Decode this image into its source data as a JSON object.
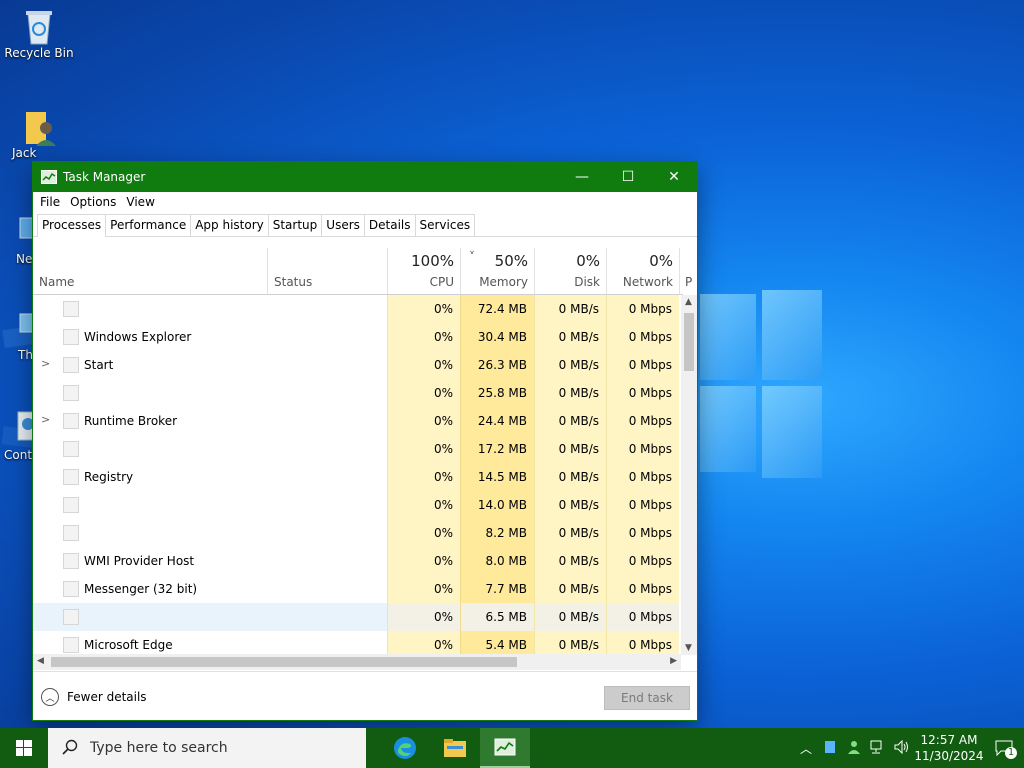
{
  "desktop": {
    "icons": [
      {
        "label": "Recycle Bin"
      },
      {
        "label": "Jack"
      },
      {
        "label": "Ne"
      },
      {
        "label": "Th"
      },
      {
        "label": "Contr"
      }
    ]
  },
  "window": {
    "title": "Task Manager",
    "controls": {
      "minimize": "—",
      "maximize": "☐",
      "close": "✕"
    },
    "menu": [
      "File",
      "Options",
      "View"
    ],
    "tabs": [
      "Processes",
      "Performance",
      "App history",
      "Startup",
      "Users",
      "Details",
      "Services"
    ],
    "active_tab": "Processes",
    "columns": {
      "name": "Name",
      "status": "Status",
      "cpu": {
        "pct": "100%",
        "label": "CPU"
      },
      "memory": {
        "pct": "50%",
        "label": "Memory",
        "sort_icon": "˅"
      },
      "disk": {
        "pct": "0%",
        "label": "Disk"
      },
      "network": {
        "pct": "0%",
        "label": "Network"
      },
      "power_partial": "P"
    },
    "rows": [
      {
        "name": "",
        "expand": "",
        "cpu": "0%",
        "memory": "72.4 MB",
        "disk": "0 MB/s",
        "network": "0 Mbps"
      },
      {
        "name": "Windows Explorer",
        "expand": "",
        "cpu": "0%",
        "memory": "30.4 MB",
        "disk": "0 MB/s",
        "network": "0 Mbps"
      },
      {
        "name": "Start",
        "expand": ">",
        "cpu": "0%",
        "memory": "26.3 MB",
        "disk": "0 MB/s",
        "network": "0 Mbps"
      },
      {
        "name": "",
        "expand": "",
        "cpu": "0%",
        "memory": "25.8 MB",
        "disk": "0 MB/s",
        "network": "0 Mbps"
      },
      {
        "name": "Runtime Broker",
        "expand": ">",
        "cpu": "0%",
        "memory": "24.4 MB",
        "disk": "0 MB/s",
        "network": "0 Mbps"
      },
      {
        "name": "",
        "expand": "",
        "cpu": "0%",
        "memory": "17.2 MB",
        "disk": "0 MB/s",
        "network": "0 Mbps"
      },
      {
        "name": "Registry",
        "expand": "",
        "cpu": "0%",
        "memory": "14.5 MB",
        "disk": "0 MB/s",
        "network": "0 Mbps"
      },
      {
        "name": "",
        "expand": "",
        "cpu": "0%",
        "memory": "14.0 MB",
        "disk": "0 MB/s",
        "network": "0 Mbps"
      },
      {
        "name": "",
        "expand": "",
        "cpu": "0%",
        "memory": "8.2 MB",
        "disk": "0 MB/s",
        "network": "0 Mbps"
      },
      {
        "name": "WMI Provider Host",
        "expand": "",
        "cpu": "0%",
        "memory": "8.0 MB",
        "disk": "0 MB/s",
        "network": "0 Mbps"
      },
      {
        "name": "Messenger (32 bit)",
        "expand": "",
        "cpu": "0%",
        "memory": "7.7 MB",
        "disk": "0 MB/s",
        "network": "0 Mbps"
      },
      {
        "name": "",
        "expand": "",
        "cpu": "0%",
        "memory": "6.5 MB",
        "disk": "0 MB/s",
        "network": "0 Mbps"
      },
      {
        "name": "Microsoft Edge",
        "expand": "",
        "cpu": "0%",
        "memory": "5.4 MB",
        "disk": "0 MB/s",
        "network": "0 Mbps"
      }
    ],
    "selected_row": 11,
    "footer": {
      "fewer_details": "Fewer details",
      "end_task": "End task"
    }
  },
  "taskbar": {
    "search_placeholder": "Type here to search",
    "apps": [
      "edge-icon",
      "file-explorer-icon",
      "task-manager-icon"
    ],
    "clock": {
      "time": "12:57 AM",
      "date": "11/30/2024"
    },
    "notification_count": "1"
  },
  "colors": {
    "titlebar": "#107c10",
    "taskbar": "#125c12",
    "memory_col": "#ffe99b",
    "other_cols": "#fff4c4"
  }
}
